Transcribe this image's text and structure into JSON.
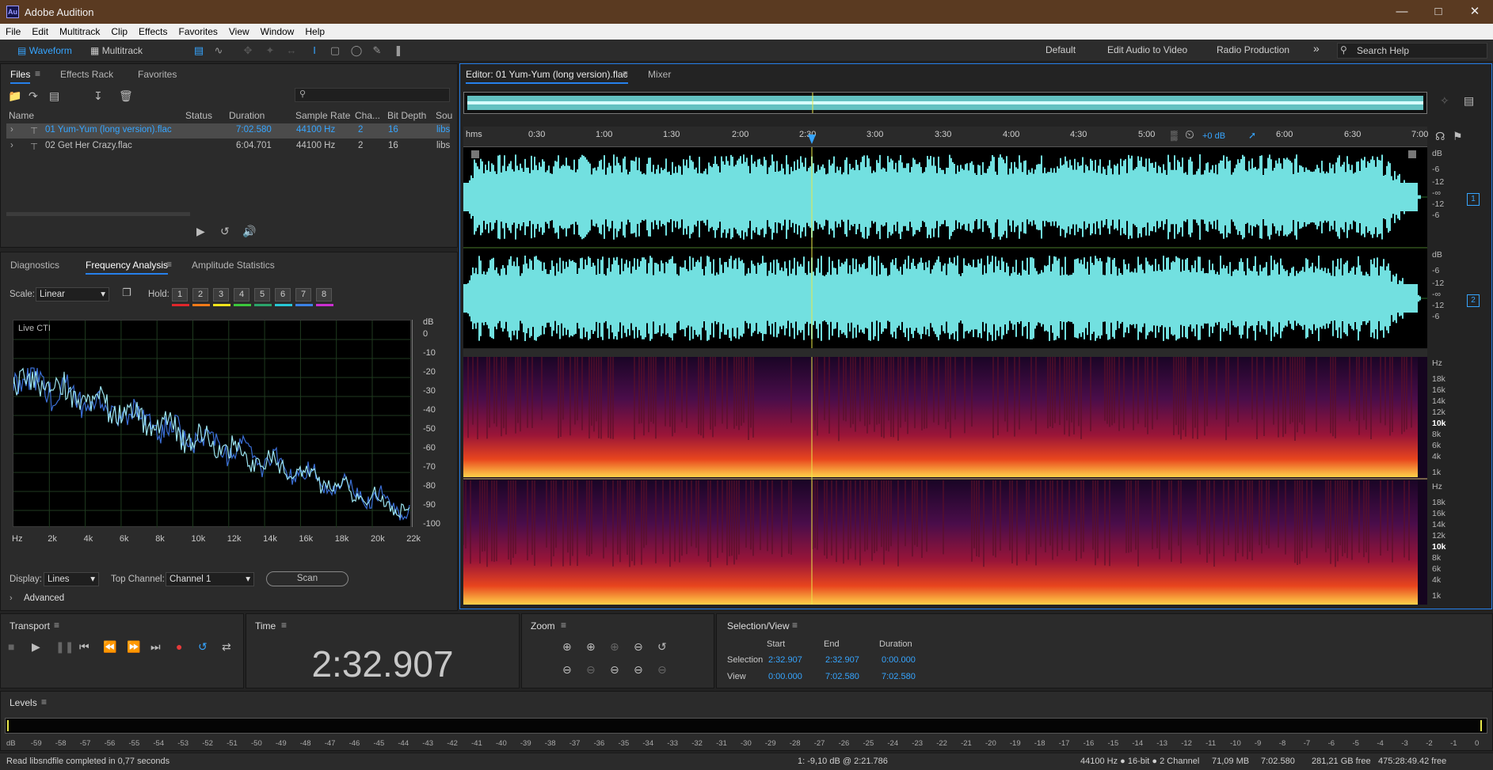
{
  "window": {
    "title": "Adobe Audition",
    "icon": "Au"
  },
  "menu": [
    "File",
    "Edit",
    "Multitrack",
    "Clip",
    "Effects",
    "Favorites",
    "View",
    "Window",
    "Help"
  ],
  "toolbar": {
    "waveform": "Waveform",
    "multitrack": "Multitrack",
    "workspaces": [
      "Default",
      "Edit Audio to Video",
      "Radio Production"
    ],
    "search_placeholder": "Search Help"
  },
  "files_panel": {
    "tabs": [
      "Files",
      "Effects Rack",
      "Favorites"
    ],
    "columns": [
      "Name",
      "Status",
      "Duration",
      "Sample Rate",
      "Cha...",
      "Bit Depth",
      "Sou"
    ],
    "rows": [
      {
        "name": "01 Yum-Yum (long version).flac",
        "duration": "7:02.580",
        "rate": "44100 Hz",
        "channels": "2",
        "bits": "16",
        "source": "libs"
      },
      {
        "name": "02 Get Her Crazy.flac",
        "duration": "6:04.701",
        "rate": "44100 Hz",
        "channels": "2",
        "bits": "16",
        "source": "libs"
      }
    ]
  },
  "analysis_panel": {
    "tabs": [
      "Diagnostics",
      "Frequency Analysis",
      "Amplitude Statistics"
    ],
    "scale_label": "Scale:",
    "scale_value": "Linear",
    "hold_label": "Hold:",
    "hold_buttons": [
      "1",
      "2",
      "3",
      "4",
      "5",
      "6",
      "7",
      "8"
    ],
    "hold_colors": [
      "#e0262b",
      "#f27a18",
      "#f2e51b",
      "#3cc83c",
      "#2aa56b",
      "#27c9d6",
      "#3b82e6",
      "#cc2fd1"
    ],
    "plot_title": "Live CTI",
    "db_label": "dB",
    "db_ticks": [
      "0",
      "-10",
      "-20",
      "-30",
      "-40",
      "-50",
      "-60",
      "-70",
      "-80",
      "-90",
      "-100"
    ],
    "hz_ticks": [
      "Hz",
      "2k",
      "4k",
      "6k",
      "8k",
      "10k",
      "12k",
      "14k",
      "16k",
      "18k",
      "20k",
      "22k"
    ],
    "display_label": "Display:",
    "display_value": "Lines",
    "top_channel_label": "Top Channel:",
    "top_channel_value": "Channel 1",
    "scan": "Scan",
    "advanced": "Advanced"
  },
  "editor": {
    "tabs": [
      "Editor: 01 Yum-Yum (long version).flac",
      "Mixer"
    ],
    "ruler_unit": "hms",
    "ruler": [
      "0:30",
      "1:00",
      "1:30",
      "2:00",
      "2:30",
      "3:00",
      "3:30",
      "4:00",
      "4:30",
      "5:00",
      "6:00",
      "6:30",
      "7:00"
    ],
    "gain": "+0 dB",
    "db_ticks": [
      "dB",
      "-6",
      "-12",
      "-∞",
      "-12",
      "-6"
    ],
    "hz_ticks": [
      "Hz",
      "18k",
      "16k",
      "14k",
      "12k",
      "10k",
      "8k",
      "6k",
      "4k",
      "1k"
    ],
    "channel_badges": [
      "1",
      "2"
    ]
  },
  "transport": {
    "title": "Transport"
  },
  "time": {
    "title": "Time",
    "value": "2:32.907"
  },
  "zoom": {
    "title": "Zoom"
  },
  "selection_view": {
    "title": "Selection/View",
    "cols": [
      "Start",
      "End",
      "Duration"
    ],
    "selection_label": "Selection",
    "selection": [
      "2:32.907",
      "2:32.907",
      "0:00.000"
    ],
    "view_label": "View",
    "view": [
      "0:00.000",
      "7:02.580",
      "7:02.580"
    ]
  },
  "levels": {
    "title": "Levels",
    "ticks": [
      "dB",
      "-59",
      "-58",
      "-57",
      "-56",
      "-55",
      "-54",
      "-53",
      "-52",
      "-51",
      "-50",
      "-49",
      "-48",
      "-47",
      "-46",
      "-45",
      "-44",
      "-43",
      "-42",
      "-41",
      "-40",
      "-39",
      "-38",
      "-37",
      "-36",
      "-35",
      "-34",
      "-33",
      "-32",
      "-31",
      "-30",
      "-29",
      "-28",
      "-27",
      "-26",
      "-25",
      "-24",
      "-23",
      "-22",
      "-21",
      "-20",
      "-19",
      "-18",
      "-17",
      "-16",
      "-15",
      "-14",
      "-13",
      "-12",
      "-11",
      "-10",
      "-9",
      "-8",
      "-7",
      "-6",
      "-5",
      "-4",
      "-3",
      "-2",
      "-1",
      "0"
    ]
  },
  "status": {
    "message": "Read libsndfile completed in 0,77 seconds",
    "cursor": "1: -9,10 dB @ 2:21.786",
    "format": "44100 Hz ● 16-bit ● 2 Channel",
    "size": "71,09 MB",
    "duration": "7:02.580",
    "free": "281,21 GB free",
    "free_time": "475:28:49.42 free"
  },
  "colors": {
    "accent": "#2680eb",
    "waveform": "#72e0e0",
    "playhead": "#e8e84a"
  }
}
